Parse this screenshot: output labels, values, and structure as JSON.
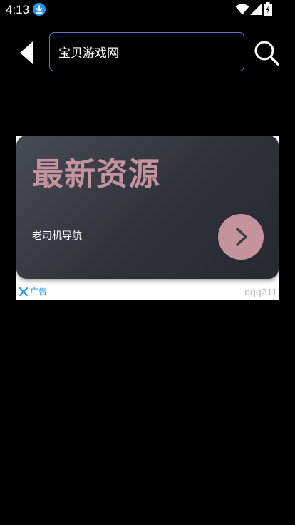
{
  "status_bar": {
    "time": "4:13",
    "icons": [
      "download-icon",
      "wifi-icon",
      "signal-icon",
      "battery-icon"
    ]
  },
  "search": {
    "value": "宝贝游戏网",
    "border_color": "#6b6fc7"
  },
  "ad": {
    "headline": "最新资源",
    "subtitle": "老司机导航",
    "label": "广告",
    "source": "qqq211",
    "accent_color": "#c5939e",
    "label_color": "#1a9af0"
  }
}
